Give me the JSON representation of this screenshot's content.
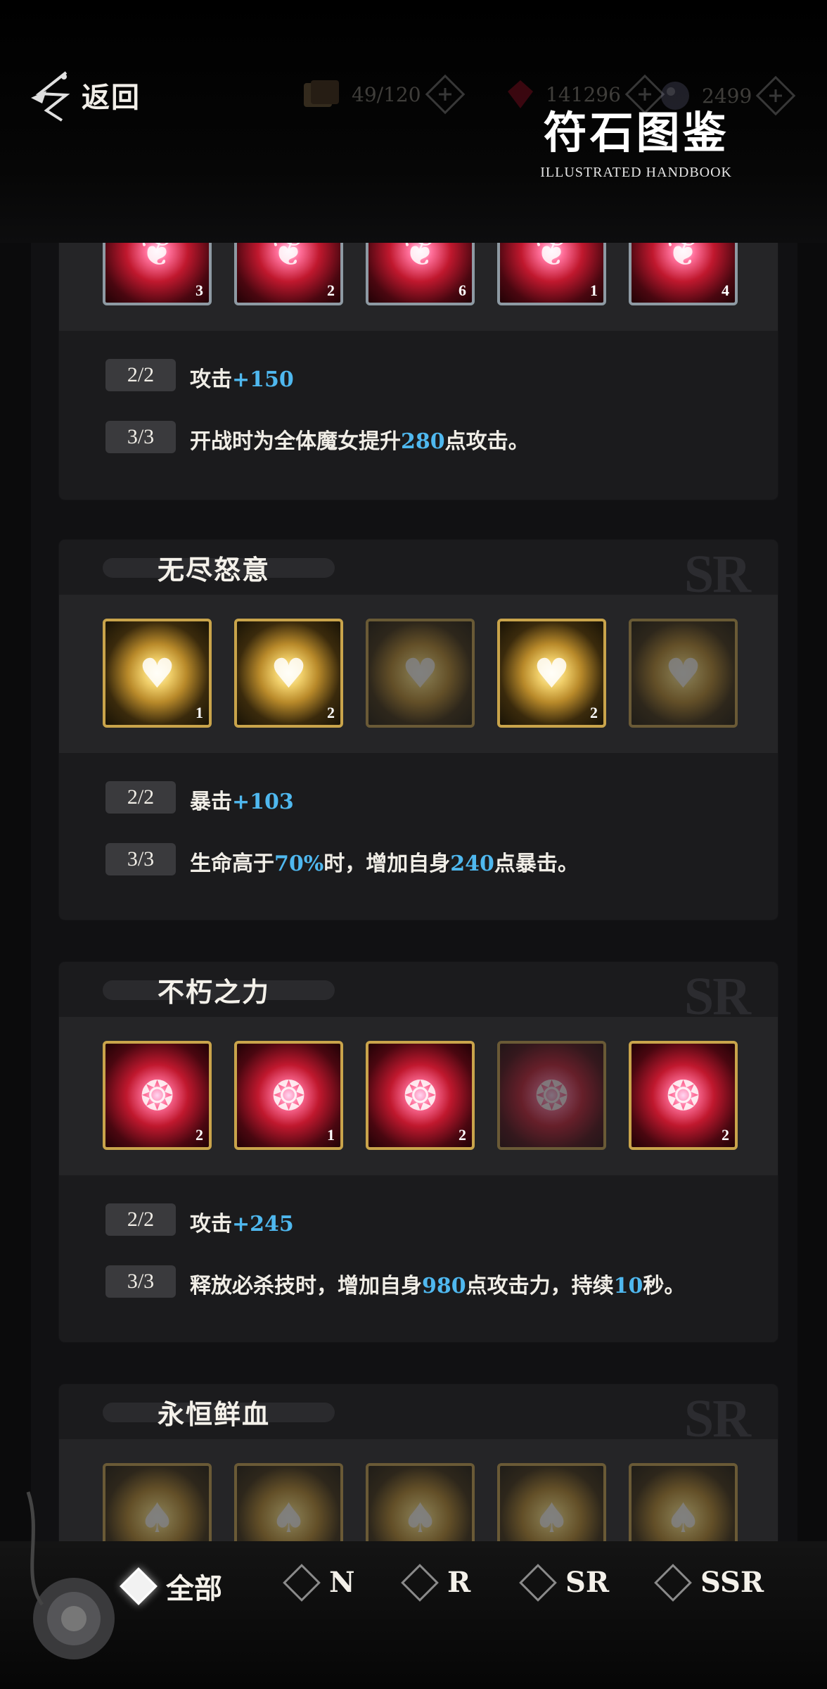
{
  "header": {
    "back_label": "返回",
    "title": "符石图鉴",
    "subtitle": "ILLUSTRATED HANDBOOK",
    "resources": [
      {
        "icon": "card-pack-icon",
        "value": "49/120"
      },
      {
        "icon": "blood-gem-icon",
        "value": "141296"
      },
      {
        "icon": "crystal-orb-icon",
        "value": "2499"
      }
    ]
  },
  "sets": [
    {
      "name": "",
      "rarity": "",
      "runes": [
        {
          "style": "red",
          "frame": "silver",
          "count": "3"
        },
        {
          "style": "red",
          "frame": "silver",
          "count": "2"
        },
        {
          "style": "red",
          "frame": "silver",
          "count": "6"
        },
        {
          "style": "red",
          "frame": "silver",
          "count": "1"
        },
        {
          "style": "red",
          "frame": "silver",
          "count": "4"
        }
      ],
      "effects": [
        {
          "tag": "2/2",
          "pre": "攻击",
          "hl1": "+150",
          "mid": "",
          "hl2": "",
          "mid2": "",
          "hl3": "",
          "post": ""
        },
        {
          "tag": "3/3",
          "pre": "开战时为全体魔女提升",
          "hl1": "280",
          "mid": "点攻击。",
          "hl2": "",
          "mid2": "",
          "hl3": "",
          "post": ""
        }
      ]
    },
    {
      "name": "无尽怒意",
      "rarity": "SR",
      "runes": [
        {
          "style": "gold",
          "frame": "gold",
          "count": "1"
        },
        {
          "style": "gold",
          "frame": "gold",
          "count": "2"
        },
        {
          "style": "gold dim",
          "frame": "gold",
          "count": ""
        },
        {
          "style": "gold",
          "frame": "gold",
          "count": "2"
        },
        {
          "style": "gold dim",
          "frame": "gold",
          "count": ""
        }
      ],
      "effects": [
        {
          "tag": "2/2",
          "pre": "暴击",
          "hl1": "+103",
          "mid": "",
          "hl2": "",
          "mid2": "",
          "hl3": "",
          "post": ""
        },
        {
          "tag": "3/3",
          "pre": "生命高于",
          "hl1": "70%",
          "mid": "时，增加自身",
          "hl2": "240",
          "mid2": "点暴击。",
          "hl3": "",
          "post": ""
        }
      ]
    },
    {
      "name": "不朽之力",
      "rarity": "SR",
      "runes": [
        {
          "style": "red",
          "frame": "gold",
          "count": "2"
        },
        {
          "style": "red",
          "frame": "gold",
          "count": "1"
        },
        {
          "style": "red",
          "frame": "gold",
          "count": "2"
        },
        {
          "style": "red dim",
          "frame": "gold",
          "count": ""
        },
        {
          "style": "red",
          "frame": "gold",
          "count": "2"
        }
      ],
      "effects": [
        {
          "tag": "2/2",
          "pre": "攻击",
          "hl1": "+245",
          "mid": "",
          "hl2": "",
          "mid2": "",
          "hl3": "",
          "post": ""
        },
        {
          "tag": "3/3",
          "pre": "释放必杀技时，增加自身",
          "hl1": "980",
          "mid": "点攻击力，持续",
          "hl2": "10",
          "mid2": "秒。",
          "hl3": "",
          "post": ""
        }
      ]
    },
    {
      "name": "永恒鲜血",
      "rarity": "SR",
      "runes": [
        {
          "style": "gold dim",
          "frame": "gold",
          "count": ""
        },
        {
          "style": "gold dim",
          "frame": "gold",
          "count": ""
        },
        {
          "style": "gold dim",
          "frame": "gold",
          "count": ""
        },
        {
          "style": "gold dim",
          "frame": "gold",
          "count": ""
        },
        {
          "style": "gold dim",
          "frame": "gold",
          "count": ""
        }
      ],
      "effects": []
    }
  ],
  "filters": [
    {
      "label": "全部",
      "selected": true
    },
    {
      "label": "N",
      "selected": false
    },
    {
      "label": "R",
      "selected": false
    },
    {
      "label": "SR",
      "selected": false
    },
    {
      "label": "SSR",
      "selected": false
    }
  ],
  "colors": {
    "highlight": "#4fb8ef",
    "gold_frame": "#c9a44b",
    "silver_frame": "#8e9aa3"
  }
}
